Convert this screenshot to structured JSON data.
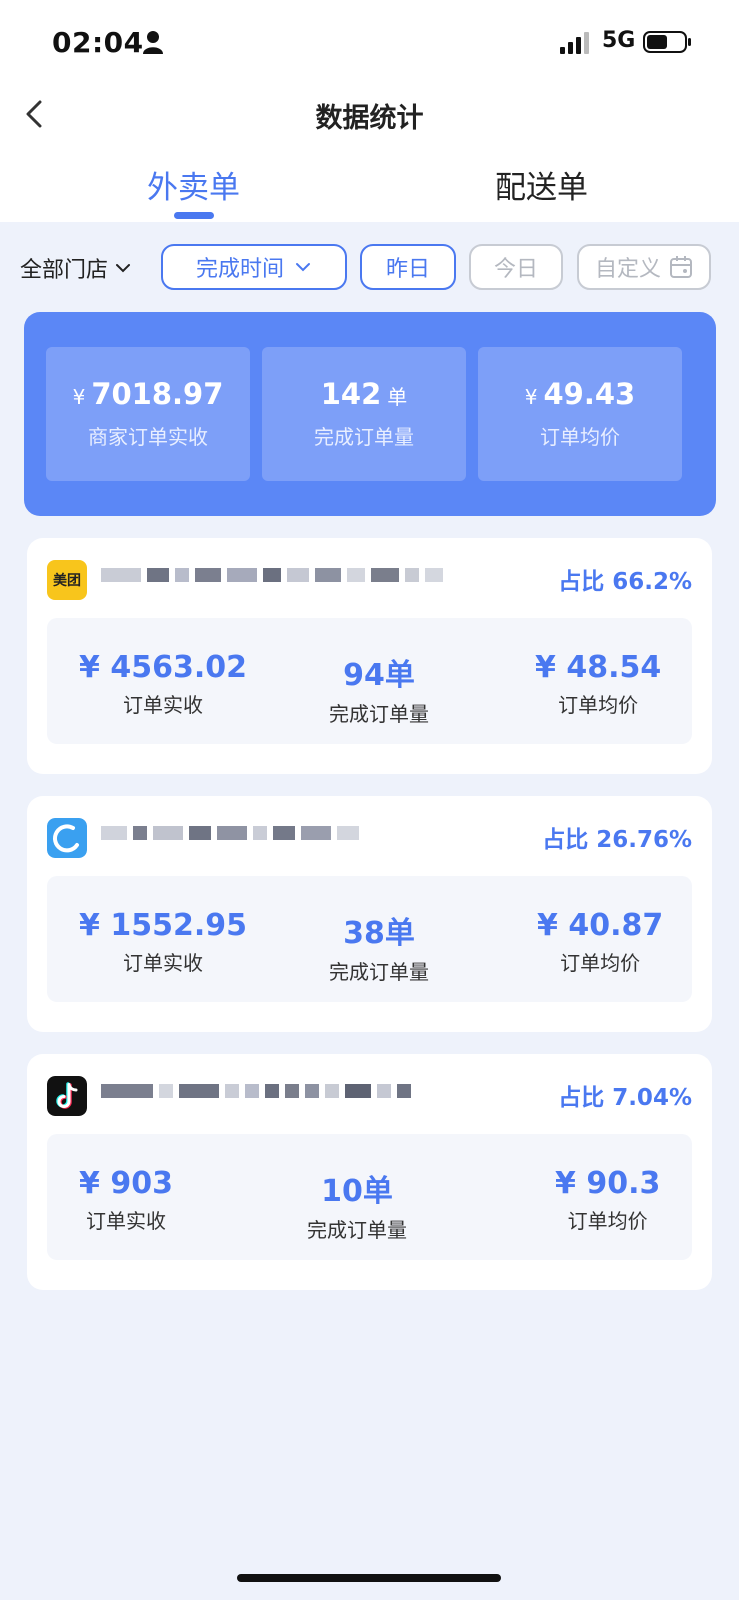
{
  "status_bar": {
    "time": "02:04",
    "network": "5G"
  },
  "nav": {
    "title": "数据统计",
    "back_icon": "chevron-left-icon"
  },
  "tabs": [
    {
      "label": "外卖单",
      "active": true
    },
    {
      "label": "配送单",
      "active": false
    }
  ],
  "filters": {
    "store": "全部门店",
    "time_type": "完成时间",
    "yesterday": "昨日",
    "today": "今日",
    "custom": "自定义"
  },
  "summary": {
    "revenue": {
      "currency": "¥",
      "value": "7018.97",
      "label": "商家订单实收"
    },
    "orders": {
      "value": "142",
      "unit": "单",
      "label": "完成订单量"
    },
    "avg": {
      "currency": "¥",
      "value": "49.43",
      "label": "订单均价"
    }
  },
  "platforms": [
    {
      "logo_text": "美团",
      "logo_color": "#f8c51c",
      "ratio": "占比 66.2%",
      "revenue": "¥ 4563.02",
      "revenue_label": "订单实收",
      "orders": "94单",
      "orders_label": "完成订单量",
      "avg": "¥ 48.54",
      "avg_label": "订单均价"
    },
    {
      "logo_text": "",
      "logo_color": "#3aa0f0",
      "ratio": "占比 26.76%",
      "revenue": "¥ 1552.95",
      "revenue_label": "订单实收",
      "orders": "38单",
      "orders_label": "完成订单量",
      "avg": "¥ 40.87",
      "avg_label": "订单均价"
    },
    {
      "logo_text": "",
      "logo_color": "#111111",
      "ratio": "占比 7.04%",
      "revenue": "¥ 903",
      "revenue_label": "订单实收",
      "orders": "10单",
      "orders_label": "完成订单量",
      "avg": "¥ 90.3",
      "avg_label": "订单均价"
    }
  ],
  "colors": {
    "accent": "#4a78f0",
    "summary_bg": "#5b87f6",
    "page_bg": "#eef2fb"
  }
}
